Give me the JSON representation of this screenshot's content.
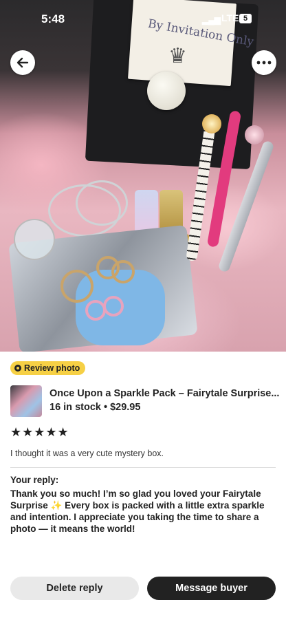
{
  "status_bar": {
    "time": "5:48",
    "network": "LTE",
    "battery": "5"
  },
  "photo": {
    "card_text": "By Invitation Only",
    "back_icon": "arrow-left-icon",
    "more_icon": "more-horizontal-icon"
  },
  "badge": {
    "label": "Review photo",
    "icon": "review-photo-icon"
  },
  "product": {
    "title": "Once Upon a Sparkle Pack – Fairytale Surprise...",
    "meta": "16 in stock • $29.95"
  },
  "rating": {
    "stars": "★★★★★",
    "value": 5
  },
  "review_text": "I thought it was a very cute mystery box.",
  "reply": {
    "label": "Your reply:",
    "text": "Thank you so much! I’m so glad you loved your Fairytale Surprise ✨ Every box is packed with a little extra sparkle and intention. I appreciate you taking the time to share a photo — it means the world!"
  },
  "actions": {
    "delete": "Delete reply",
    "message": "Message buyer"
  },
  "colors": {
    "badge": "#f6d045",
    "primary_button": "#222222",
    "secondary_button": "#e9e9e9"
  }
}
